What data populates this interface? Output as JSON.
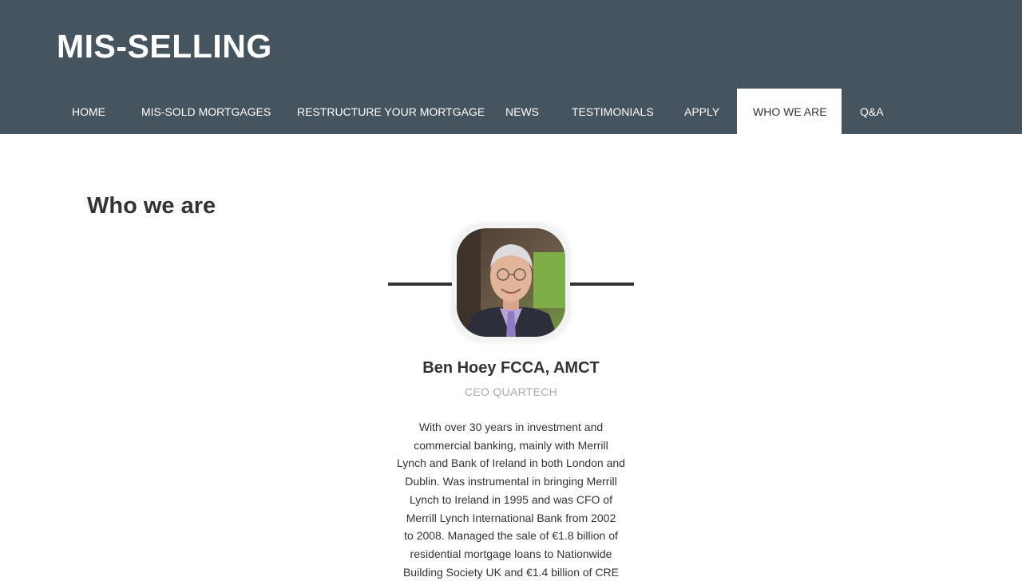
{
  "site": {
    "logo": "MIS-SELLING"
  },
  "nav": {
    "items": [
      {
        "label": "HOME"
      },
      {
        "label": "MIS-SOLD MORTGAGES"
      },
      {
        "label": "RESTRUCTURE YOUR MORTGAGE"
      },
      {
        "label": "NEWS"
      },
      {
        "label": "TESTIMONIALS"
      },
      {
        "label": "APPLY"
      },
      {
        "label": "WHO WE ARE"
      },
      {
        "label": "Q&A"
      }
    ],
    "active_index": 6
  },
  "main": {
    "title": "Who we are"
  },
  "profile": {
    "name": "Ben Hoey FCCA, AMCT",
    "role": "CEO QUARTECH",
    "bio_lines": [
      "With over 30 years in investment and",
      "commercial banking, mainly with Merrill",
      "Lynch and Bank of Ireland in both London and",
      "Dublin. Was instrumental in bringing Merrill",
      "Lynch to Ireland in 1995 and was CFO of",
      "Merrill Lynch International Bank from 2002",
      "to 2008. Managed the sale of €1.8 billion of",
      "residential mortgage loans to Nationwide",
      "Building Society UK and €1.4 billion of CRE"
    ]
  },
  "colors": {
    "header_bg": "#46545f",
    "text": "#333333",
    "muted": "#aaaaaa"
  }
}
